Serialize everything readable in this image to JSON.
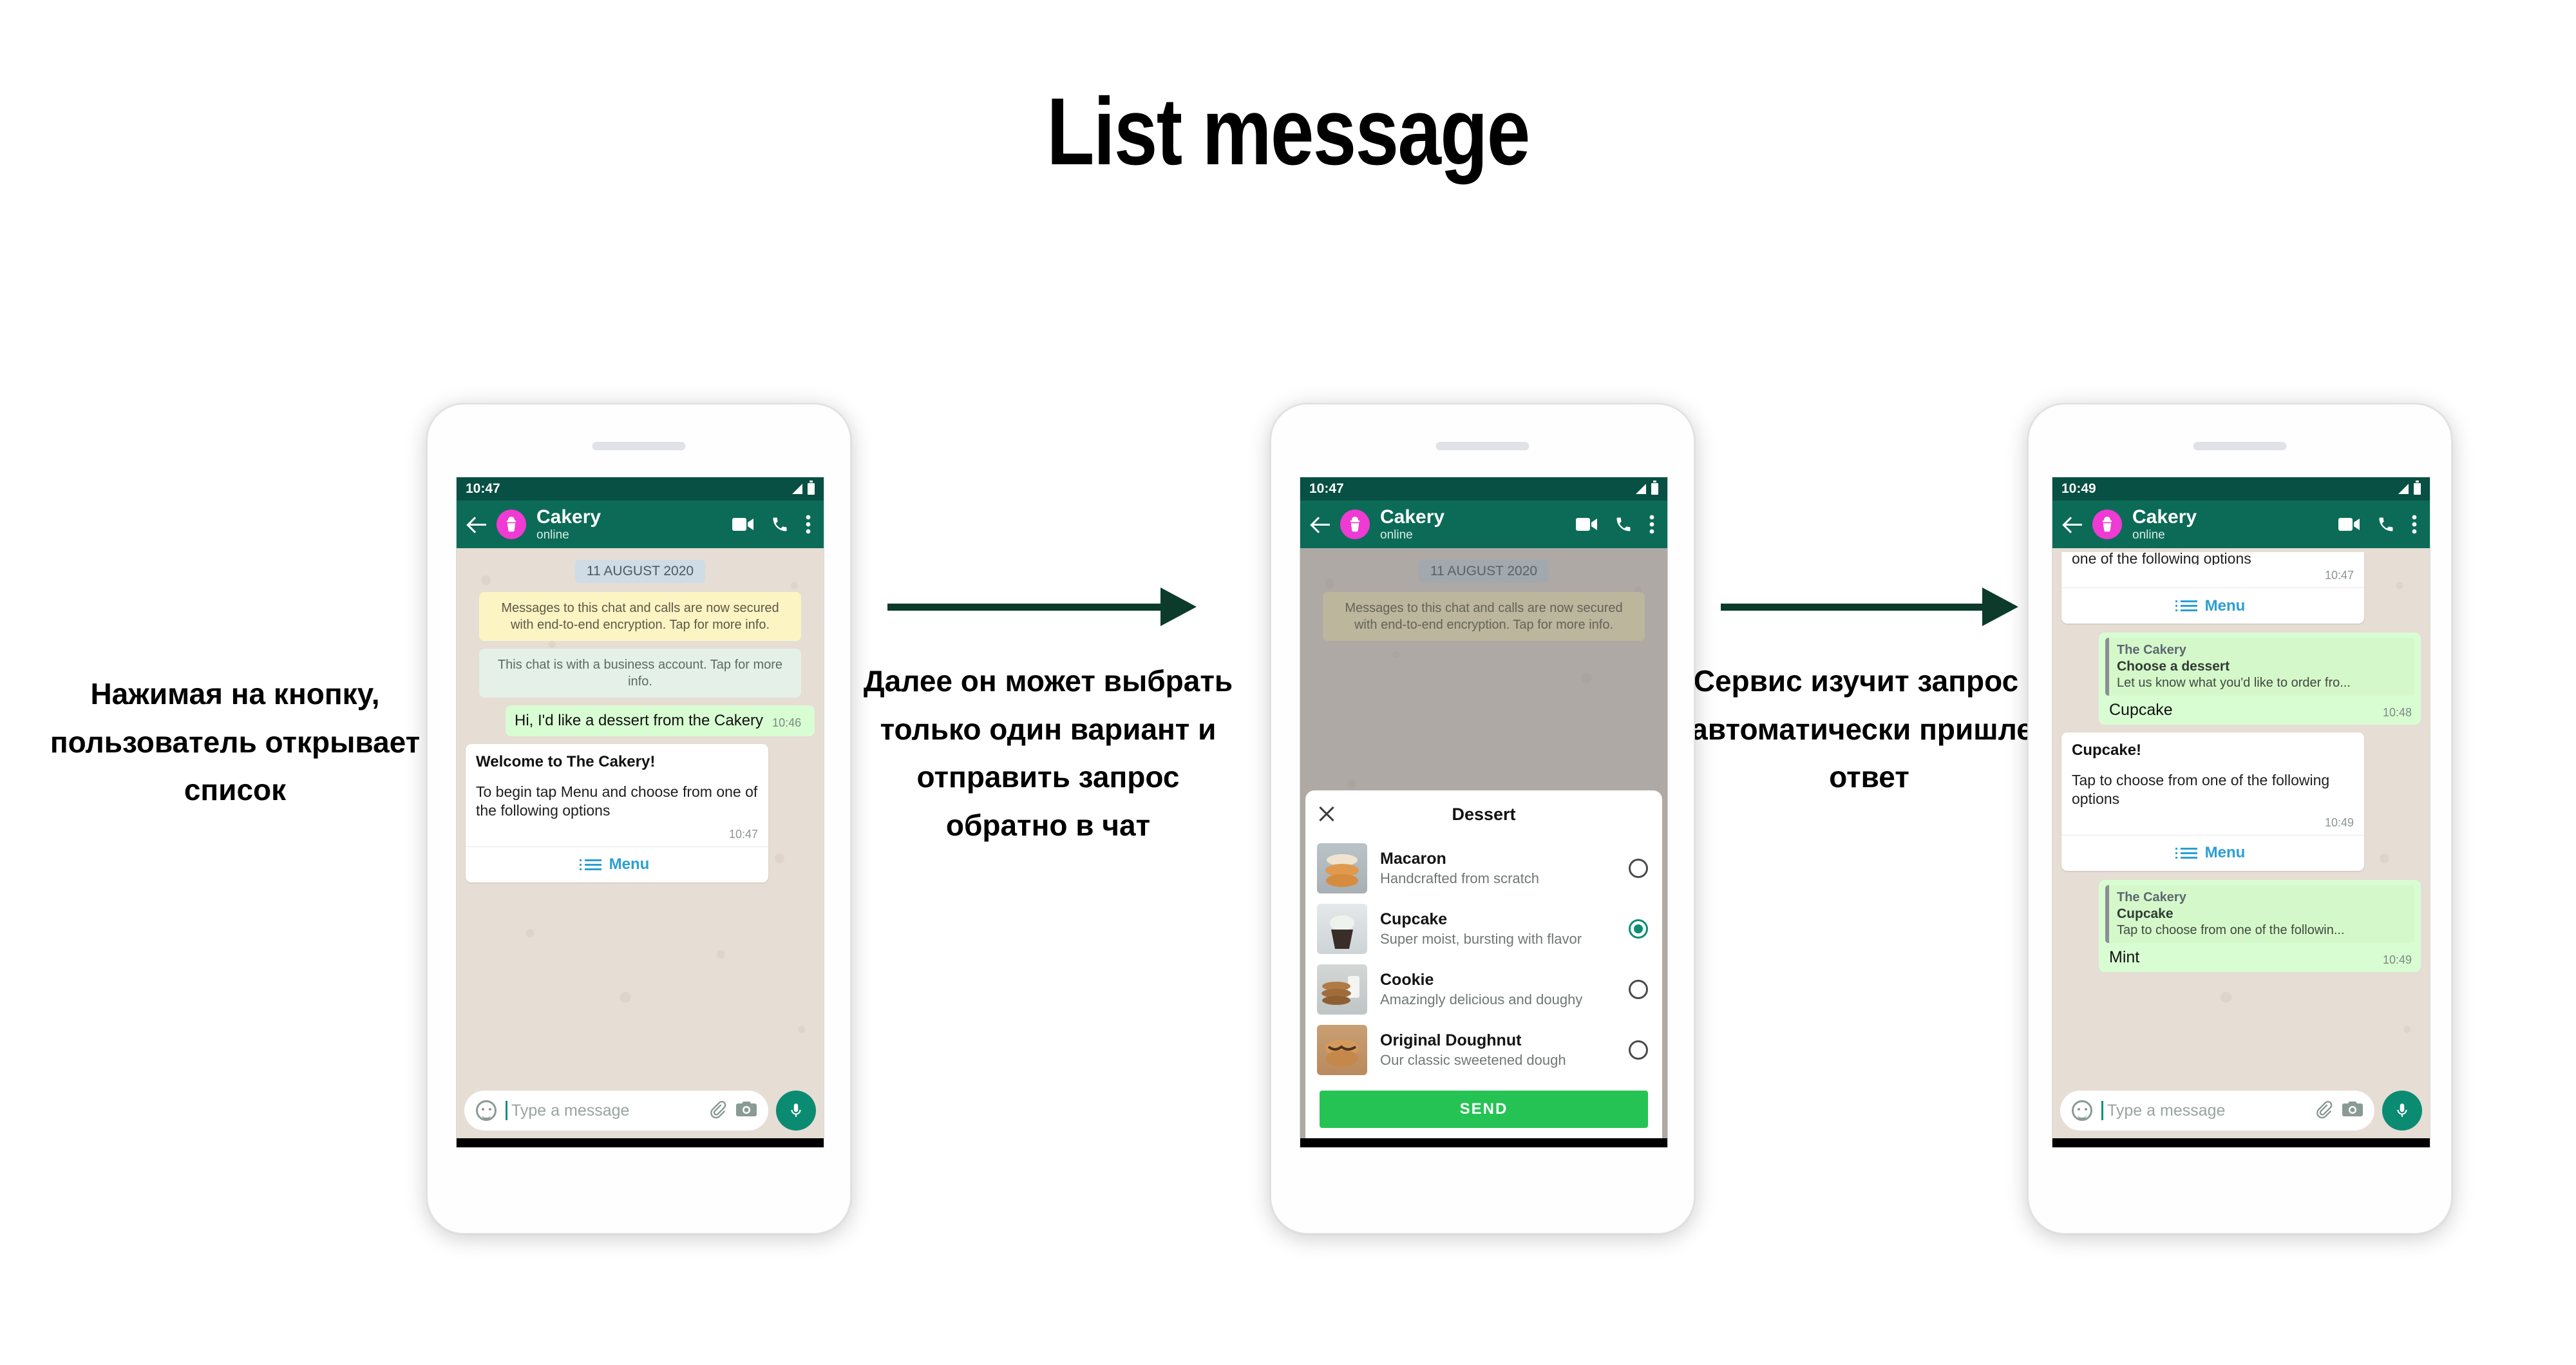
{
  "title": "List message",
  "captions": {
    "left": "Нажимая на кнопку, пользователь открывает список",
    "middle": "Далее он может выбрать только один вариант и отправить запрос обратно в чат",
    "right": "Сервис изучит запрос и автоматически пришлет ответ"
  },
  "colors": {
    "appbar": "#0b6b57",
    "statusbar": "#075043",
    "chat_bg": "#e6ddd4",
    "outgoing_bubble": "#d9fdd3",
    "accent_link": "#2b9fd3",
    "avatar": "#ef3ad3",
    "send_button": "#25c354",
    "arrow": "#0c3b2b",
    "radio_selected": "#0a8f74"
  },
  "phones": [
    {
      "status_time": "10:47",
      "contact_name": "Cakery",
      "contact_status": "online",
      "date_chip": "11 AUGUST 2020",
      "system_messages": [
        "Messages to this chat and calls are now secured with end-to-end encryption. Tap for more info.",
        "This chat is with a business account. Tap for more info."
      ],
      "user_message": {
        "text": "Hi, I'd like a dessert from the Cakery",
        "time": "10:46"
      },
      "card": {
        "title": "Welcome to The Cakery!",
        "text": "To begin tap Menu and choose from one of the following options",
        "time": "10:47",
        "action_label": "Menu"
      },
      "composer": {
        "placeholder": "Type a message"
      }
    },
    {
      "status_time": "10:47",
      "contact_name": "Cakery",
      "contact_status": "online",
      "date_chip": "11 AUGUST 2020",
      "system_messages": [
        "Messages to this chat and calls are now secured with end-to-end encryption. Tap for more info."
      ],
      "sheet": {
        "title": "Dessert",
        "send_label": "SEND",
        "options": [
          {
            "name": "Macaron",
            "desc": "Handcrafted from scratch",
            "selected": false
          },
          {
            "name": "Cupcake",
            "desc": "Super moist, bursting with flavor",
            "selected": true
          },
          {
            "name": "Cookie",
            "desc": "Amazingly delicious and doughy",
            "selected": false
          },
          {
            "name": "Original Doughnut",
            "desc": "Our classic sweetened dough",
            "selected": false
          }
        ]
      }
    },
    {
      "status_time": "10:49",
      "contact_name": "Cakery",
      "contact_status": "online",
      "scrolled_card": {
        "cut_text": "one of the following options",
        "time": "10:47",
        "action_label": "Menu"
      },
      "reply_1": {
        "quote_name": "The Cakery",
        "quote_line1": "Choose a dessert",
        "quote_line2": "Let us know what you'd like to order fro...",
        "answer": "Cupcake",
        "time": "10:48"
      },
      "card_2": {
        "title": "Cupcake!",
        "text": "Tap to choose from one of the following options",
        "time": "10:49",
        "action_label": "Menu"
      },
      "reply_2": {
        "quote_name": "The Cakery",
        "quote_line1": "Cupcake",
        "quote_line2": "Tap to choose from one of the followin...",
        "answer": "Mint",
        "time": "10:49"
      },
      "composer": {
        "placeholder": "Type a message"
      }
    }
  ]
}
